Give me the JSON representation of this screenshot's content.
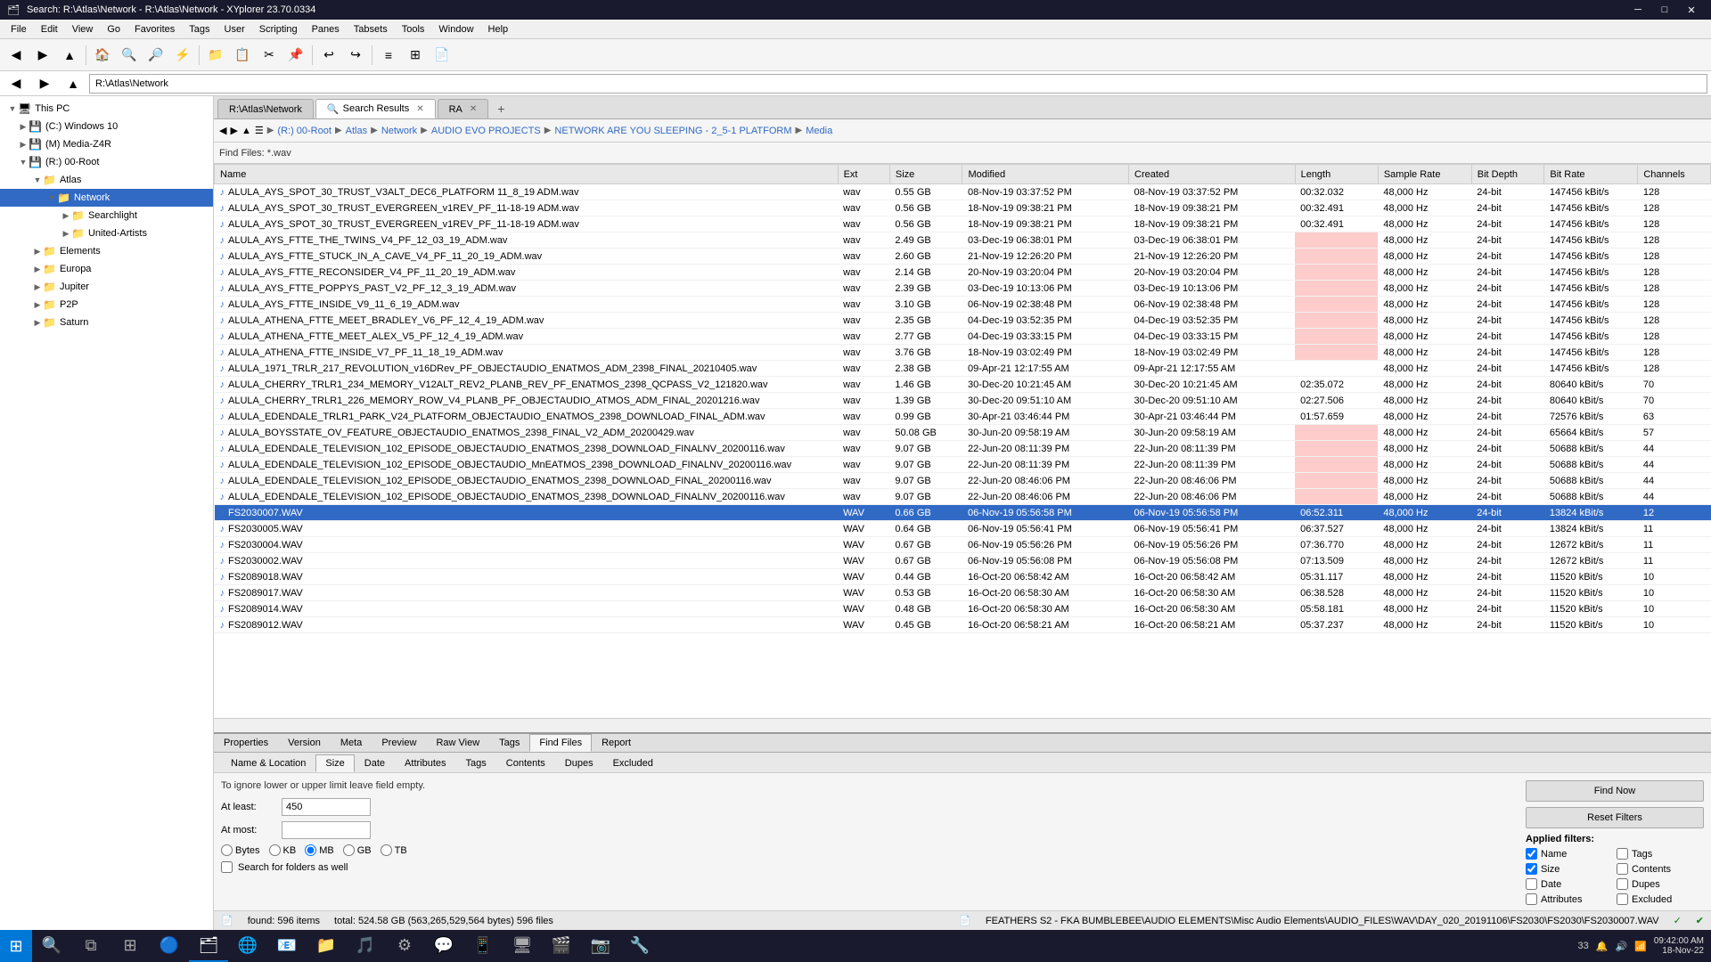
{
  "titlebar": {
    "title": "Search: R:\\Atlas\\Network - R:\\Atlas\\Network - XYplorer 23.70.0334",
    "controls": [
      "minimize",
      "maximize",
      "close"
    ]
  },
  "menubar": {
    "items": [
      "File",
      "Edit",
      "View",
      "Go",
      "Favorites",
      "Tags",
      "User",
      "Scripting",
      "Panes",
      "Tabsets",
      "Tools",
      "Window",
      "Help"
    ]
  },
  "address": {
    "location": "R:\\Atlas\\Network",
    "breadcrumb": [
      "(R:) 00-Root",
      "Atlas",
      "Network",
      "AUDIO EVO PROJECTS",
      "NETWORK ARE YOU SLEEPING - 2_5-1 PLATFORM",
      "Media"
    ]
  },
  "tabs": {
    "items": [
      {
        "label": "R:\\Atlas\\Network",
        "active": false
      },
      {
        "label": "Search Results",
        "active": true
      },
      {
        "label": "RA",
        "active": false
      }
    ]
  },
  "search_bar": {
    "label": "Find Files: *.wav"
  },
  "tree": {
    "items": [
      {
        "label": "This PC",
        "level": 0,
        "icon": "🖥",
        "expanded": true
      },
      {
        "label": "(C:) Windows 10",
        "level": 1,
        "icon": "💾",
        "expanded": false
      },
      {
        "label": "(M) Media-Z4R",
        "level": 1,
        "icon": "💾",
        "expanded": false
      },
      {
        "label": "(R:) 00-Root",
        "level": 1,
        "icon": "💾",
        "expanded": true
      },
      {
        "label": "Atlas",
        "level": 2,
        "icon": "📁",
        "expanded": true
      },
      {
        "label": "Network",
        "level": 3,
        "icon": "📁",
        "expanded": true,
        "selected": true
      },
      {
        "label": "Searchlight",
        "level": 4,
        "icon": "📁",
        "expanded": false
      },
      {
        "label": "United-Artists",
        "level": 4,
        "icon": "📁",
        "expanded": false
      },
      {
        "label": "Elements",
        "level": 2,
        "icon": "📁",
        "expanded": false
      },
      {
        "label": "Europa",
        "level": 2,
        "icon": "📁",
        "expanded": false
      },
      {
        "label": "Jupiter",
        "level": 2,
        "icon": "📁",
        "expanded": false
      },
      {
        "label": "P2P",
        "level": 2,
        "icon": "📁",
        "expanded": false
      },
      {
        "label": "Saturn",
        "level": 2,
        "icon": "📁",
        "expanded": false
      }
    ]
  },
  "file_list": {
    "columns": [
      "Name",
      "Ext",
      "Size",
      "Modified",
      "Created",
      "Length",
      "Sample Rate",
      "Bit Depth",
      "Bit Rate",
      "Channels"
    ],
    "rows": [
      {
        "name": "ALULA_AYS_SPOT_30_TRUST_V3ALT_DEC6_PLATFORM 11_8_19 ADM.wav",
        "ext": "wav",
        "size": "0.55 GB",
        "modified": "08-Nov-19 03:37:52 PM",
        "created": "08-Nov-19 03:37:52 PM",
        "length": "00:32.032",
        "samplerate": "48,000 Hz",
        "bitdepth": "24-bit",
        "bitrate": "147456 kBit/s",
        "channels": "128"
      },
      {
        "name": "ALULA_AYS_SPOT_30_TRUST_EVERGREEN_v1REV_PF_11-18-19 ADM.wav",
        "ext": "wav",
        "size": "0.56 GB",
        "modified": "18-Nov-19 09:38:21 PM",
        "created": "18-Nov-19 09:38:21 PM",
        "length": "00:32.491",
        "samplerate": "48,000 Hz",
        "bitdepth": "24-bit",
        "bitrate": "147456 kBit/s",
        "channels": "128"
      },
      {
        "name": "ALULA_AYS_SPOT_30_TRUST_EVERGREEN_v1REV_PF_11-18-19 ADM.wav",
        "ext": "wav",
        "size": "0.56 GB",
        "modified": "18-Nov-19 09:38:21 PM",
        "created": "18-Nov-19 09:38:21 PM",
        "length": "00:32.491",
        "samplerate": "48,000 Hz",
        "bitdepth": "24-bit",
        "bitrate": "147456 kBit/s",
        "channels": "128"
      },
      {
        "name": "ALULA_AYS_FTTE_THE_TWINS_V4_PF_12_03_19_ADM.wav",
        "ext": "wav",
        "size": "2.49 GB",
        "modified": "03-Dec-19 06:38:01 PM",
        "created": "03-Dec-19 06:38:01 PM",
        "length": "",
        "samplerate": "48,000 Hz",
        "bitdepth": "24-bit",
        "bitrate": "147456 kBit/s",
        "channels": "128",
        "highlight_length": true
      },
      {
        "name": "ALULA_AYS_FTTE_STUCK_IN_A_CAVE_V4_PF_11_20_19_ADM.wav",
        "ext": "wav",
        "size": "2.60 GB",
        "modified": "21-Nov-19 12:26:20 PM",
        "created": "21-Nov-19 12:26:20 PM",
        "length": "",
        "samplerate": "48,000 Hz",
        "bitdepth": "24-bit",
        "bitrate": "147456 kBit/s",
        "channels": "128",
        "highlight_length": true
      },
      {
        "name": "ALULA_AYS_FTTE_RECONSIDER_V4_PF_11_20_19_ADM.wav",
        "ext": "wav",
        "size": "2.14 GB",
        "modified": "20-Nov-19 03:20:04 PM",
        "created": "20-Nov-19 03:20:04 PM",
        "length": "",
        "samplerate": "48,000 Hz",
        "bitdepth": "24-bit",
        "bitrate": "147456 kBit/s",
        "channels": "128",
        "highlight_length": true
      },
      {
        "name": "ALULA_AYS_FTTE_POPPYS_PAST_V2_PF_12_3_19_ADM.wav",
        "ext": "wav",
        "size": "2.39 GB",
        "modified": "03-Dec-19 10:13:06 PM",
        "created": "03-Dec-19 10:13:06 PM",
        "length": "",
        "samplerate": "48,000 Hz",
        "bitdepth": "24-bit",
        "bitrate": "147456 kBit/s",
        "channels": "128",
        "highlight_length": true
      },
      {
        "name": "ALULA_AYS_FTTE_INSIDE_V9_11_6_19_ADM.wav",
        "ext": "wav",
        "size": "3.10 GB",
        "modified": "06-Nov-19 02:38:48 PM",
        "created": "06-Nov-19 02:38:48 PM",
        "length": "",
        "samplerate": "48,000 Hz",
        "bitdepth": "24-bit",
        "bitrate": "147456 kBit/s",
        "channels": "128",
        "highlight_length": true
      },
      {
        "name": "ALULA_ATHENA_FTTE_MEET_BRADLEY_V6_PF_12_4_19_ADM.wav",
        "ext": "wav",
        "size": "2.35 GB",
        "modified": "04-Dec-19 03:52:35 PM",
        "created": "04-Dec-19 03:52:35 PM",
        "length": "",
        "samplerate": "48,000 Hz",
        "bitdepth": "24-bit",
        "bitrate": "147456 kBit/s",
        "channels": "128",
        "highlight_length": true
      },
      {
        "name": "ALULA_ATHENA_FTTE_MEET_ALEX_V5_PF_12_4_19_ADM.wav",
        "ext": "wav",
        "size": "2.77 GB",
        "modified": "04-Dec-19 03:33:15 PM",
        "created": "04-Dec-19 03:33:15 PM",
        "length": "",
        "samplerate": "48,000 Hz",
        "bitdepth": "24-bit",
        "bitrate": "147456 kBit/s",
        "channels": "128",
        "highlight_length": true
      },
      {
        "name": "ALULA_ATHENA_FTTE_INSIDE_V7_PF_11_18_19_ADM.wav",
        "ext": "wav",
        "size": "3.76 GB",
        "modified": "18-Nov-19 03:02:49 PM",
        "created": "18-Nov-19 03:02:49 PM",
        "length": "",
        "samplerate": "48,000 Hz",
        "bitdepth": "24-bit",
        "bitrate": "147456 kBit/s",
        "channels": "128",
        "highlight_length": true
      },
      {
        "name": "ALULA_1971_TRLR_217_REVOLUTION_v16DRev_PF_OBJECTAUDIO_ENATMOS_ADM_2398_FINAL_20210405.wav",
        "ext": "wav",
        "size": "2.38 GB",
        "modified": "09-Apr-21 12:17:55 AM",
        "created": "09-Apr-21 12:17:55 AM",
        "length": "",
        "samplerate": "48,000 Hz",
        "bitdepth": "24-bit",
        "bitrate": "147456 kBit/s",
        "channels": "128"
      },
      {
        "name": "ALULA_CHERRY_TRLR1_234_MEMORY_V12ALT_REV2_PLANB_REV_PF_ENATMOS_2398_QCPASS_V2_121820.wav",
        "ext": "wav",
        "size": "1.46 GB",
        "modified": "30-Dec-20 10:21:45 AM",
        "created": "30-Dec-20 10:21:45 AM",
        "length": "02:35.072",
        "samplerate": "48,000 Hz",
        "bitdepth": "24-bit",
        "bitrate": "80640 kBit/s",
        "channels": "70"
      },
      {
        "name": "ALULA_CHERRY_TRLR1_226_MEMORY_ROW_V4_PLANB_PF_OBJECTAUDIO_ATMOS_ADM_FINAL_20201216.wav",
        "ext": "wav",
        "size": "1.39 GB",
        "modified": "30-Dec-20 09:51:10 AM",
        "created": "30-Dec-20 09:51:10 AM",
        "length": "02:27.506",
        "samplerate": "48,000 Hz",
        "bitdepth": "24-bit",
        "bitrate": "80640 kBit/s",
        "channels": "70"
      },
      {
        "name": "ALULA_EDENDALE_TRLR1_PARK_V24_PLATFORM_OBJECTAUDIO_ENATMOS_2398_DOWNLOAD_FINAL_ADM.wav",
        "ext": "wav",
        "size": "0.99 GB",
        "modified": "30-Apr-21 03:46:44 PM",
        "created": "30-Apr-21 03:46:44 PM",
        "length": "01:57.659",
        "samplerate": "48,000 Hz",
        "bitdepth": "24-bit",
        "bitrate": "72576 kBit/s",
        "channels": "63"
      },
      {
        "name": "ALULA_BOYSSTATE_OV_FEATURE_OBJECTAUDIO_ENATMOS_2398_FINAL_V2_ADM_20200429.wav",
        "ext": "wav",
        "size": "50.08 GB",
        "modified": "30-Jun-20 09:58:19 AM",
        "created": "30-Jun-20 09:58:19 AM",
        "length": "",
        "samplerate": "48,000 Hz",
        "bitdepth": "24-bit",
        "bitrate": "65664 kBit/s",
        "channels": "57",
        "highlight_length": true
      },
      {
        "name": "ALULA_EDENDALE_TELEVISION_102_EPISODE_OBJECTAUDIO_ENATMOS_2398_DOWNLOAD_FINALNV_20200116.wav",
        "ext": "wav",
        "size": "9.07 GB",
        "modified": "22-Jun-20 08:11:39 PM",
        "created": "22-Jun-20 08:11:39 PM",
        "length": "",
        "samplerate": "48,000 Hz",
        "bitdepth": "24-bit",
        "bitrate": "50688 kBit/s",
        "channels": "44",
        "highlight_length": true
      },
      {
        "name": "ALULA_EDENDALE_TELEVISION_102_EPISODE_OBJECTAUDIO_MnEATMOS_2398_DOWNLOAD_FINALNV_20200116.wav",
        "ext": "wav",
        "size": "9.07 GB",
        "modified": "22-Jun-20 08:11:39 PM",
        "created": "22-Jun-20 08:11:39 PM",
        "length": "",
        "samplerate": "48,000 Hz",
        "bitdepth": "24-bit",
        "bitrate": "50688 kBit/s",
        "channels": "44",
        "highlight_length": true
      },
      {
        "name": "ALULA_EDENDALE_TELEVISION_102_EPISODE_OBJECTAUDIO_ENATMOS_2398_DOWNLOAD_FINAL_20200116.wav",
        "ext": "wav",
        "size": "9.07 GB",
        "modified": "22-Jun-20 08:46:06 PM",
        "created": "22-Jun-20 08:46:06 PM",
        "length": "",
        "samplerate": "48,000 Hz",
        "bitdepth": "24-bit",
        "bitrate": "50688 kBit/s",
        "channels": "44",
        "highlight_length": true
      },
      {
        "name": "ALULA_EDENDALE_TELEVISION_102_EPISODE_OBJECTAUDIO_ENATMOS_2398_DOWNLOAD_FINALNV_20200116.wav",
        "ext": "wav",
        "size": "9.07 GB",
        "modified": "22-Jun-20 08:46:06 PM",
        "created": "22-Jun-20 08:46:06 PM",
        "length": "",
        "samplerate": "48,000 Hz",
        "bitdepth": "24-bit",
        "bitrate": "50688 kBit/s",
        "channels": "44",
        "highlight_length": true
      },
      {
        "name": "FS2030007.WAV",
        "ext": "WAV",
        "size": "0.66 GB",
        "modified": "06-Nov-19 05:56:58 PM",
        "created": "06-Nov-19 05:56:58 PM",
        "length": "06:52.311",
        "samplerate": "48,000 Hz",
        "bitdepth": "24-bit",
        "bitrate": "13824 kBit/s",
        "channels": "12",
        "selected": true
      },
      {
        "name": "FS2030005.WAV",
        "ext": "WAV",
        "size": "0.64 GB",
        "modified": "06-Nov-19 05:56:41 PM",
        "created": "06-Nov-19 05:56:41 PM",
        "length": "06:37.527",
        "samplerate": "48,000 Hz",
        "bitdepth": "24-bit",
        "bitrate": "13824 kBit/s",
        "channels": "11"
      },
      {
        "name": "FS2030004.WAV",
        "ext": "WAV",
        "size": "0.67 GB",
        "modified": "06-Nov-19 05:56:26 PM",
        "created": "06-Nov-19 05:56:26 PM",
        "length": "07:36.770",
        "samplerate": "48,000 Hz",
        "bitdepth": "24-bit",
        "bitrate": "12672 kBit/s",
        "channels": "11"
      },
      {
        "name": "FS2030002.WAV",
        "ext": "WAV",
        "size": "0.67 GB",
        "modified": "06-Nov-19 05:56:08 PM",
        "created": "06-Nov-19 05:56:08 PM",
        "length": "07:13.509",
        "samplerate": "48,000 Hz",
        "bitdepth": "24-bit",
        "bitrate": "12672 kBit/s",
        "channels": "11"
      },
      {
        "name": "FS2089018.WAV",
        "ext": "WAV",
        "size": "0.44 GB",
        "modified": "16-Oct-20 06:58:42 AM",
        "created": "16-Oct-20 06:58:42 AM",
        "length": "05:31.117",
        "samplerate": "48,000 Hz",
        "bitdepth": "24-bit",
        "bitrate": "11520 kBit/s",
        "channels": "10"
      },
      {
        "name": "FS2089017.WAV",
        "ext": "WAV",
        "size": "0.53 GB",
        "modified": "16-Oct-20 06:58:30 AM",
        "created": "16-Oct-20 06:58:30 AM",
        "length": "06:38.528",
        "samplerate": "48,000 Hz",
        "bitdepth": "24-bit",
        "bitrate": "11520 kBit/s",
        "channels": "10"
      },
      {
        "name": "FS2089014.WAV",
        "ext": "WAV",
        "size": "0.48 GB",
        "modified": "16-Oct-20 06:58:30 AM",
        "created": "16-Oct-20 06:58:30 AM",
        "length": "05:58.181",
        "samplerate": "48,000 Hz",
        "bitdepth": "24-bit",
        "bitrate": "11520 kBit/s",
        "channels": "10"
      },
      {
        "name": "FS2089012.WAV",
        "ext": "WAV",
        "size": "0.45 GB",
        "modified": "16-Oct-20 06:58:21 AM",
        "created": "16-Oct-20 06:58:21 AM",
        "length": "05:37.237",
        "samplerate": "48,000 Hz",
        "bitdepth": "24-bit",
        "bitrate": "11520 kBit/s",
        "channels": "10"
      }
    ]
  },
  "status": {
    "found": "found: 596 items",
    "total": "total: 524.58 GB (563,265,529,564 bytes)   596 files",
    "path": "FEATHERS S2 - FKA BUMBLEBEE\\AUDIO ELEMENTS\\Misc Audio Elements\\AUDIO_FILES\\WAV\\DAY_020_20191106\\FS2030\\FS2030\\FS2030007.WAV"
  },
  "bottom_panel": {
    "tabs": [
      "Properties",
      "Version",
      "Meta",
      "Preview",
      "Raw View",
      "Tags",
      "Find Files",
      "Report"
    ],
    "active_tab": "Find Files",
    "sub_tabs": [
      "Name & Location",
      "Size",
      "Date",
      "Attributes",
      "Tags",
      "Contents",
      "Dupes",
      "Excluded"
    ],
    "active_sub_tab": "Size",
    "hint_text": "To ignore lower or upper limit leave field empty.",
    "at_least_label": "At least:",
    "at_least_value": "450",
    "at_most_label": "At most:",
    "at_most_value": "",
    "units": [
      "Bytes",
      "KB",
      "MB",
      "GB",
      "TB"
    ],
    "selected_unit": "MB",
    "search_folders_label": "Search for folders as well",
    "find_now_label": "Find Now",
    "reset_filters_label": "Reset Filters",
    "applied_filters_title": "Applied filters:",
    "filters": {
      "Name": true,
      "Tags": false,
      "Size": true,
      "Contents": false,
      "Date": false,
      "Dupes": false,
      "Attributes": false,
      "Excluded": false
    }
  },
  "taskbar": {
    "time": "09:42:00 AM",
    "date": "18-Nov-22",
    "counter": "33"
  }
}
